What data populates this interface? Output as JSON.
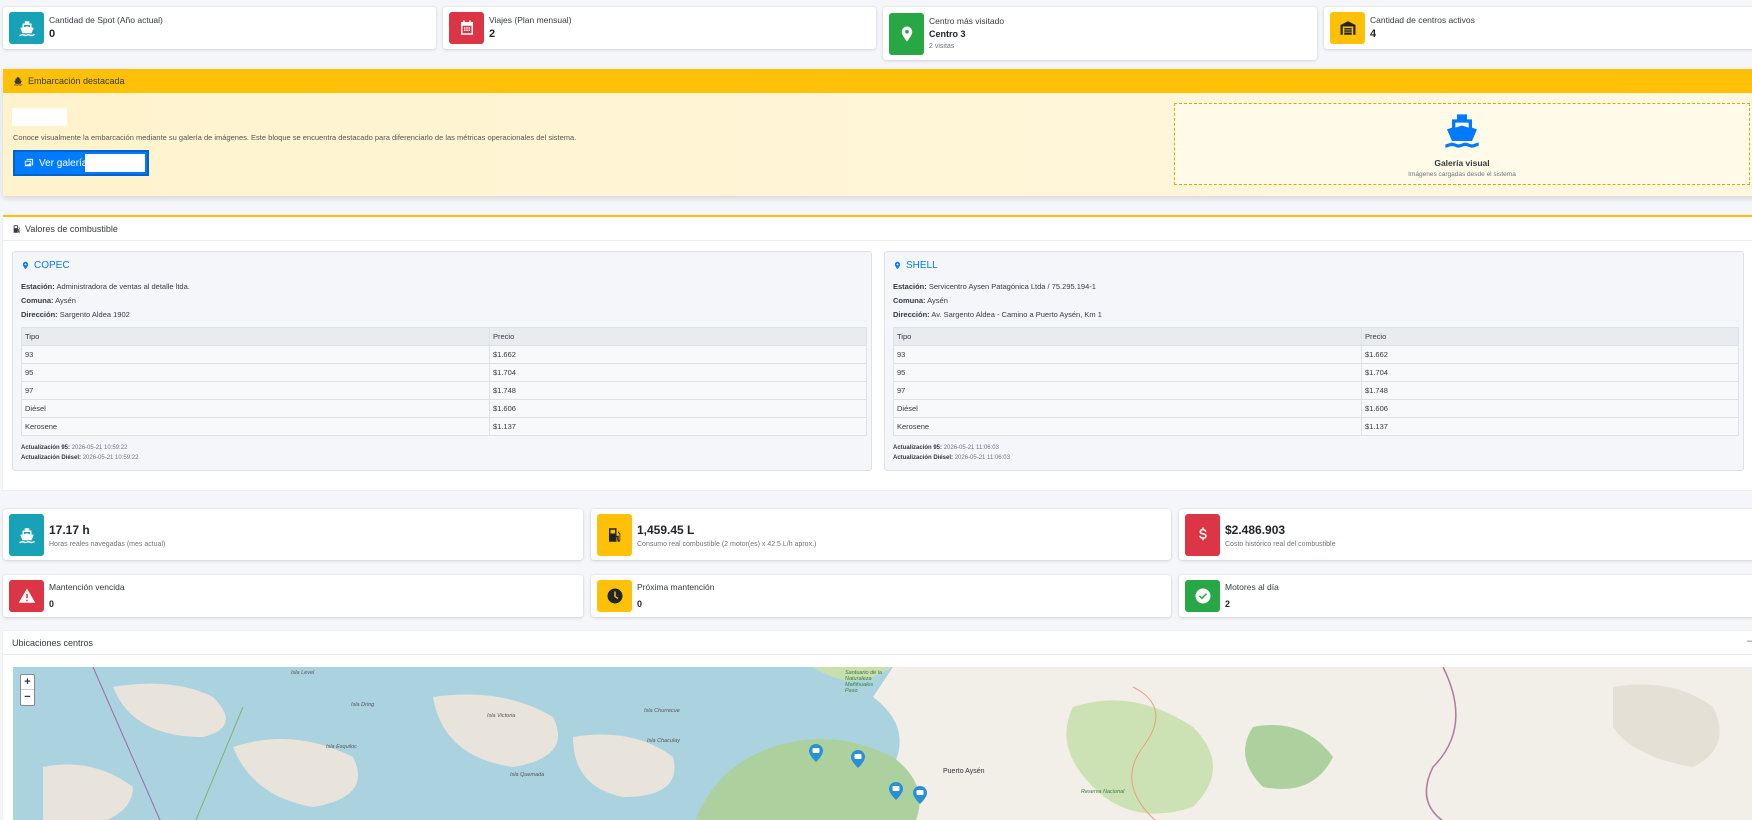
{
  "stats_top": [
    {
      "label": "Cantidad de Spot (Año actual)",
      "value": "0",
      "icon": "ship-icon",
      "color": "#17a2b8"
    },
    {
      "label": "Viajes (Plan mensual)",
      "value": "2",
      "icon": "calendar-icon",
      "color": "#dc3545"
    },
    {
      "label": "Centro más visitado",
      "value": "Centro 3",
      "sub": "2 visitas",
      "icon": "map-pin-icon",
      "color": "#28a745"
    },
    {
      "label": "Cantidad de centros activos",
      "value": "4",
      "icon": "warehouse-icon",
      "color": "#ffc107"
    }
  ],
  "featured": {
    "header": "Embarcación destacada",
    "description": "Conoce visualmente la embarcación mediante su galería de imágenes. Este bloque se encuentra destacado para diferenciarlo de las métricas operacionales del sistema.",
    "button_label": "Ver galería",
    "gallery_title": "Galería visual",
    "gallery_sub": "Imágenes cargadas desde el sistema"
  },
  "fuel": {
    "header": "Valores de combustible",
    "col_type": "Tipo",
    "col_price": "Precio",
    "stations": [
      {
        "name": "COPEC",
        "station_label": "Estación:",
        "station": "Administradora de ventas al detalle ltda.",
        "commune_label": "Comuna:",
        "commune": "Aysén",
        "address_label": "Dirección:",
        "address": "Sargento Aldea 1902",
        "prices": [
          {
            "type": "93",
            "price": "$1.662"
          },
          {
            "type": "95",
            "price": "$1.704"
          },
          {
            "type": "97",
            "price": "$1.748"
          },
          {
            "type": "Diésel",
            "price": "$1.606"
          },
          {
            "type": "Kerosene",
            "price": "$1.137"
          }
        ],
        "update95_label": "Actualización 95:",
        "update95": "2026-05-21 10:59:22",
        "updateD_label": "Actualización Diésel:",
        "updateD": "2026-05-21 10:59:22"
      },
      {
        "name": "SHELL",
        "station_label": "Estación:",
        "station": "Servicentro Aysen Patagónica Ltda / 75.295.194-1",
        "commune_label": "Comuna:",
        "commune": "Aysén",
        "address_label": "Dirección:",
        "address": "Av. Sargento Aldea - Camino a Puerto Aysén, Km 1",
        "prices": [
          {
            "type": "93",
            "price": "$1.662"
          },
          {
            "type": "95",
            "price": "$1.704"
          },
          {
            "type": "97",
            "price": "$1.748"
          },
          {
            "type": "Diésel",
            "price": "$1.606"
          },
          {
            "type": "Kerosene",
            "price": "$1.137"
          }
        ],
        "update95_label": "Actualización 95:",
        "update95": "2026-05-21 11:06:03",
        "updateD_label": "Actualización Diésel:",
        "updateD": "2026-05-21 11:06:03"
      }
    ]
  },
  "metrics": [
    {
      "value": "17.17 h",
      "sub": "Horas reales navegadas (mes actual)",
      "icon": "ship-icon",
      "color": "#17a2b8"
    },
    {
      "value": "1,459.45 L",
      "sub": "Consumo real combustible (2 motor(es) x 42.5 L/h aprox.)",
      "icon": "fuel-pump-icon",
      "color": "#ffc107"
    },
    {
      "value": "$2.486.903",
      "sub": "Costo histórico real del combustible",
      "icon": "dollar-icon",
      "color": "#dc3545"
    }
  ],
  "maintenance": [
    {
      "label": "Mantención vencida",
      "value": "0",
      "icon": "warning-icon",
      "color": "#dc3545"
    },
    {
      "label": "Próxima mantención",
      "value": "0",
      "icon": "clock-icon",
      "color": "#ffc107"
    },
    {
      "label": "Motores al día",
      "value": "2",
      "icon": "check-circle-icon",
      "color": "#28a745"
    }
  ],
  "map": {
    "header": "Ubicaciones centros",
    "collapse": "–",
    "zoom_in": "+",
    "zoom_out": "−",
    "labels": {
      "l1": "Isla Level",
      "l2": "Isla Dring",
      "l3": "Isla Victoria",
      "l4": "Isla Churrecue",
      "l5": "Isla Chaculay",
      "l6": "Isla Esquiloc",
      "l7": "Isla Quemada",
      "l8": "Santuario de la Naturaleza Mañihuales Paso",
      "l9": "Puerto Aysén",
      "l10": "Reserva Nacional"
    }
  }
}
